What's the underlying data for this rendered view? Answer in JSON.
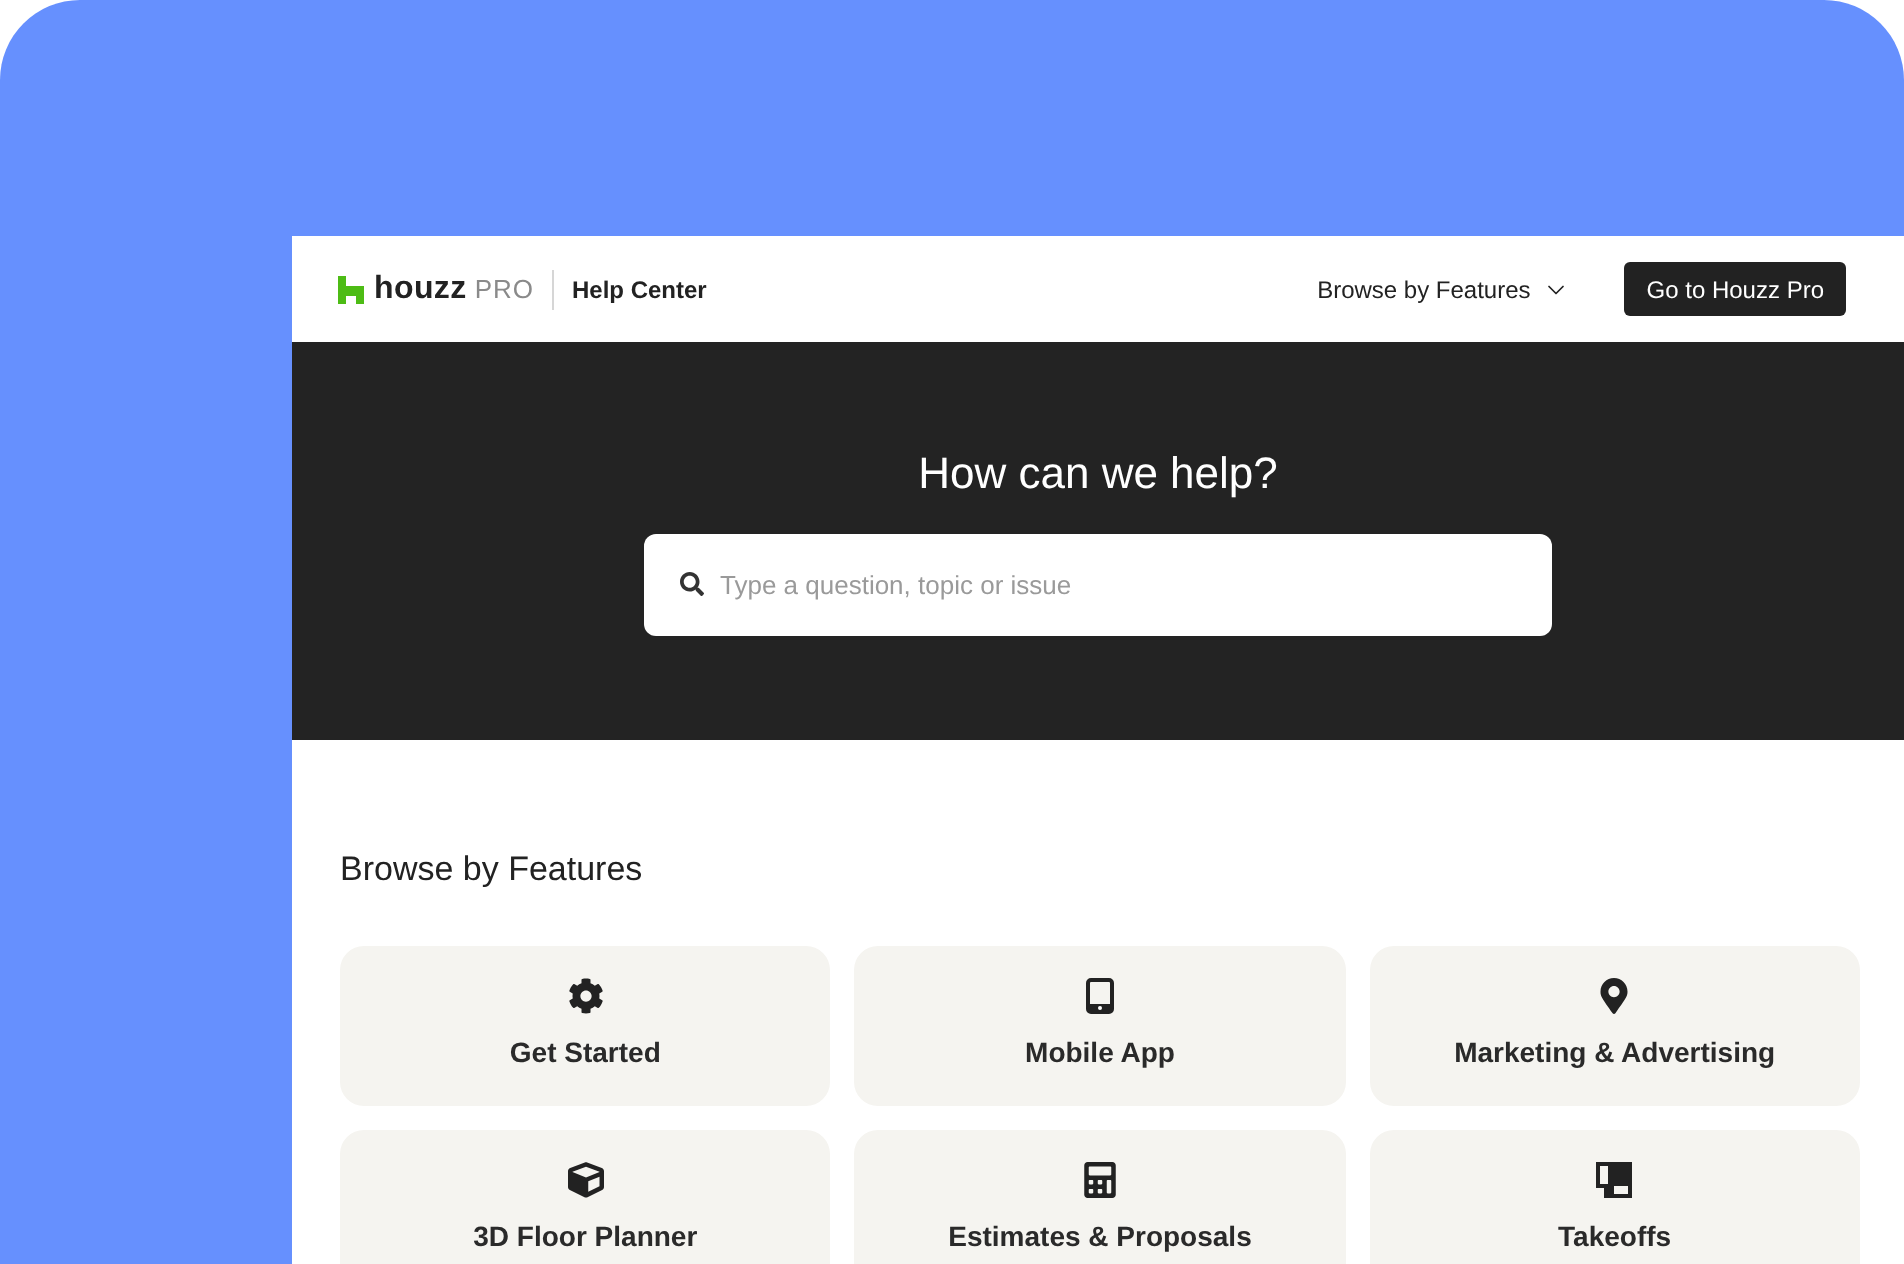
{
  "header": {
    "logo": {
      "wordmark": "houzz",
      "badge": "PRO"
    },
    "section_title": "Help Center",
    "nav_menu": "Browse by Features",
    "cta_button": "Go to Houzz Pro"
  },
  "hero": {
    "title": "How can we help?",
    "search": {
      "placeholder": "Type a question, topic or issue"
    }
  },
  "features": {
    "title": "Browse by Features",
    "cards": [
      {
        "kind": "gear",
        "label": "Get Started"
      },
      {
        "kind": "phone",
        "label": "Mobile App"
      },
      {
        "kind": "pin",
        "label": "Marketing & Advertising"
      },
      {
        "kind": "cube",
        "label": "3D Floor Planner"
      },
      {
        "kind": "calculator",
        "label": "Estimates & Proposals"
      },
      {
        "kind": "takeoff",
        "label": "Takeoffs"
      }
    ]
  }
}
